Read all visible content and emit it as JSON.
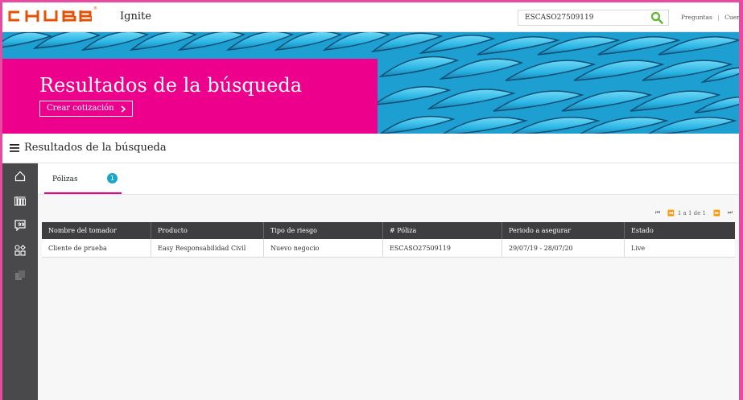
{
  "brand": {
    "logo_text": "CHUBB",
    "reg_mark": "®",
    "logo_color": "#e35205"
  },
  "app": {
    "title": "Ignite"
  },
  "search": {
    "value": "ESCASO27509119"
  },
  "help": {
    "faq": "Preguntas",
    "separator": "|",
    "account": "Cuenta"
  },
  "banner": {
    "title": "Resultados de la búsqueda",
    "button_label": "Crear cotización",
    "button_icon": "chevron-right-icon"
  },
  "section": {
    "title": "Resultados de la búsqueda"
  },
  "sidebar": {
    "items": [
      "home-icon",
      "calculator-icon",
      "chat-quote-icon",
      "shapes-icon",
      "documents-icon"
    ]
  },
  "tabs": [
    {
      "label": "Pólizas",
      "count": "1"
    }
  ],
  "pager": {
    "text": "1 a 1 de 1"
  },
  "table": {
    "headers": [
      "Nombre del tomador",
      "Producto",
      "Tipo de riesgo",
      "# Póliza",
      "Periodo a asegurar",
      "Estado"
    ],
    "rows": [
      [
        "Cliente de prueba",
        "Easy Responsabilidad Civil",
        "Nuevo negocio",
        "ESCASO27509119",
        "29/07/19 - 28/07/20",
        "Live"
      ]
    ]
  },
  "colors": {
    "accent": "#ec008c",
    "badge": "#1ba6c9",
    "sidebar": "#49494b",
    "table_header": "#3e3e40",
    "search_icon": "#5fb72f"
  }
}
